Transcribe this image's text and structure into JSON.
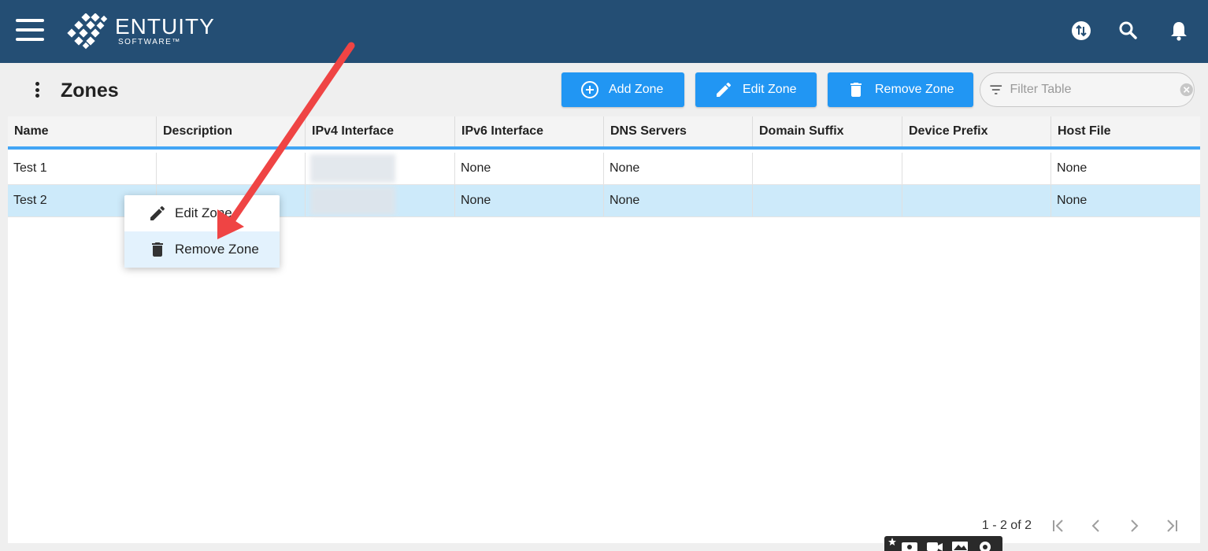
{
  "header": {
    "logo_main": "ENTUITY",
    "logo_sub": "SOFTWARE™",
    "icons": [
      "menu-icon",
      "sync-icon",
      "search-icon",
      "bell-icon"
    ],
    "color": "#244e74"
  },
  "page": {
    "title": "Zones"
  },
  "toolbar": {
    "add_label": "Add Zone",
    "edit_label": "Edit Zone",
    "remove_label": "Remove Zone",
    "filter_placeholder": "Filter Table",
    "accent": "#2196f3"
  },
  "table": {
    "columns": [
      "Name",
      "Description",
      "IPv4 Interface",
      "IPv6 Interface",
      "DNS Servers",
      "Domain Suffix",
      "Device Prefix",
      "Host File"
    ],
    "rows": [
      {
        "name": "Test 1",
        "description": "",
        "ipv4": "",
        "ipv6": "None",
        "dns": "None",
        "domain_suffix": "",
        "device_prefix": "",
        "host_file": "None",
        "selected": false
      },
      {
        "name": "Test 2",
        "description": "",
        "ipv4": "",
        "ipv6": "None",
        "dns": "None",
        "domain_suffix": "",
        "device_prefix": "",
        "host_file": "None",
        "selected": true
      }
    ],
    "selected_color": "#cdeafa"
  },
  "context_menu": {
    "items": [
      {
        "label": "Edit Zone",
        "icon": "pencil-icon"
      },
      {
        "label": "Remove Zone",
        "icon": "trash-icon"
      }
    ]
  },
  "pagination": {
    "range_text": "1 - 2 of 2"
  },
  "annotation": {
    "arrow_color": "#ef4444"
  }
}
